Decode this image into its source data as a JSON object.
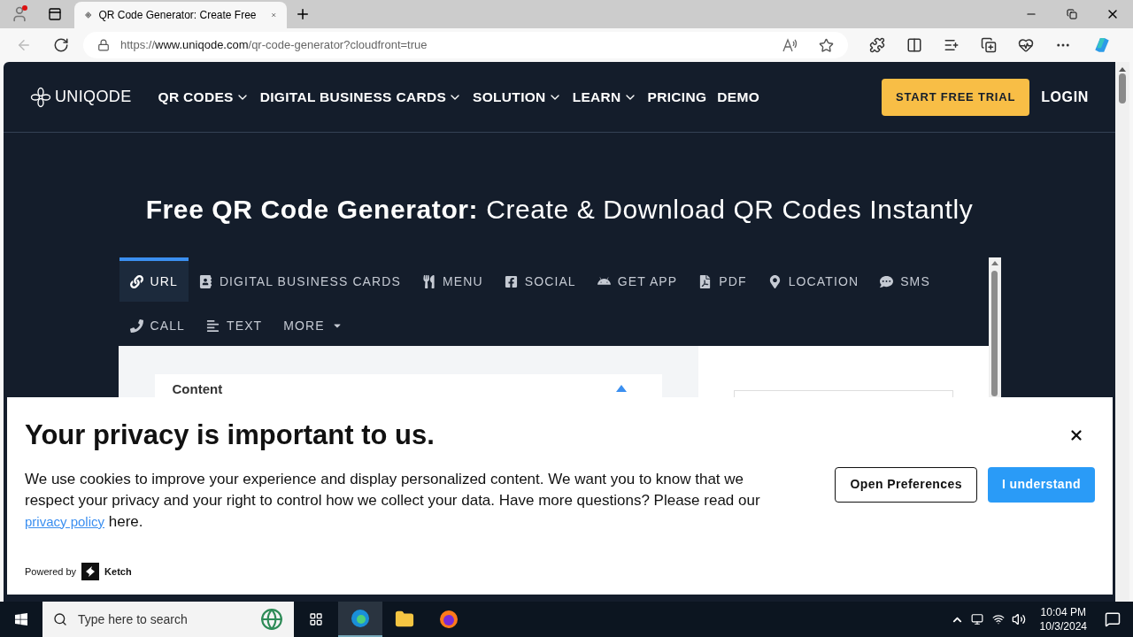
{
  "browser": {
    "tab": {
      "title": "QR Code Generator: Create Free",
      "selected": true
    },
    "url": {
      "scheme": "https://",
      "host": "www.uniqode.com",
      "path": "/qr-code-generator?cloudfront=true"
    }
  },
  "site_header": {
    "logo": "UNIQODE",
    "nav": [
      {
        "label": "QR CODES",
        "has_menu": true
      },
      {
        "label": "DIGITAL BUSINESS CARDS",
        "has_menu": true
      },
      {
        "label": "SOLUTION",
        "has_menu": true
      },
      {
        "label": "LEARN",
        "has_menu": true
      },
      {
        "label": "PRICING",
        "has_menu": false
      },
      {
        "label": "DEMO",
        "has_menu": false
      }
    ],
    "trial_button": "START FREE TRIAL",
    "login": "LOGIN"
  },
  "hero_title": "**Free QR Code Generator:** Create & Download QR Codes Instantly",
  "qr_tabs": [
    {
      "label": "URL",
      "selected": true
    },
    {
      "label": "DIGITAL BUSINESS CARDS",
      "selected": false
    },
    {
      "label": "MENU",
      "selected": false
    },
    {
      "label": "SOCIAL",
      "selected": false
    },
    {
      "label": "GET APP",
      "selected": false
    },
    {
      "label": "PDF",
      "selected": false
    },
    {
      "label": "LOCATION",
      "selected": false
    },
    {
      "label": "SMS",
      "selected": false
    },
    {
      "label": "CALL",
      "selected": false
    },
    {
      "label": "TEXT",
      "selected": false
    },
    {
      "label": "MORE",
      "selected": false
    }
  ],
  "content_card": {
    "title": "Content",
    "expanded": true
  },
  "cookie_banner": {
    "title": "Your privacy is important to us.",
    "body": "We use cookies to improve your experience and display personalized content. We want you to know that we respect your privacy and your right to control how we collect your data. Have more questions? Please read our",
    "link": "privacy policy",
    "body_end": "here.",
    "buttons": [
      {
        "label": "Open Preferences",
        "kind": "outline"
      },
      {
        "label": "I understand",
        "kind": "primary"
      }
    ],
    "powered_by": "Powered by",
    "brand": "Ketch"
  },
  "taskbar": {
    "search_placeholder": "Type here to search",
    "time": "10:04 PM",
    "date": "10/3/2024"
  }
}
